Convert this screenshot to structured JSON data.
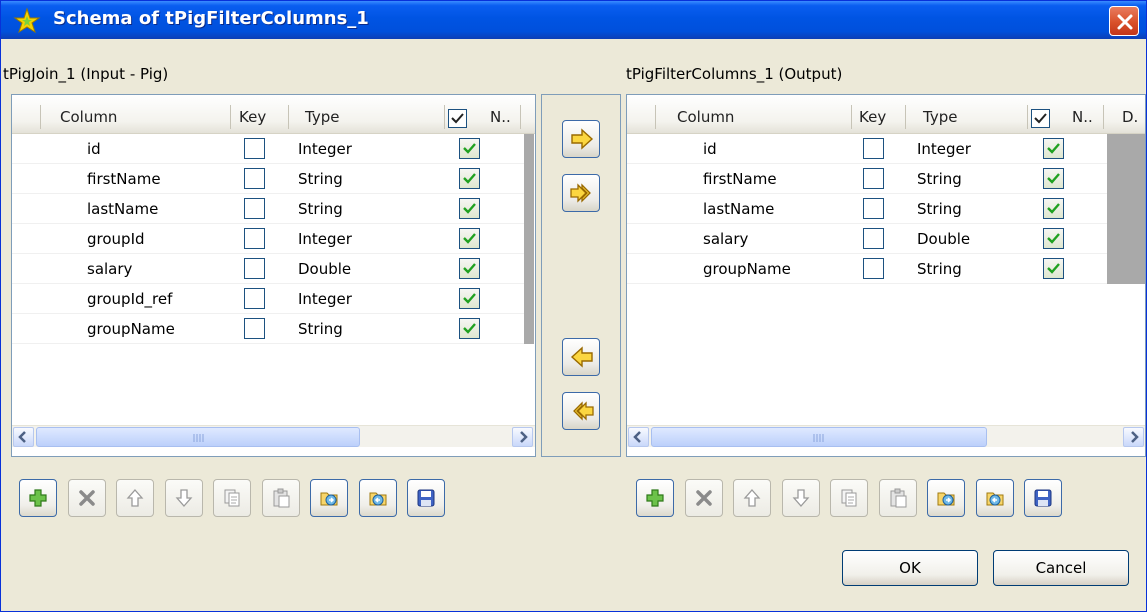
{
  "window": {
    "title": "Schema of tPigFilterColumns_1",
    "accent": "#0054e3"
  },
  "input_panel": {
    "label": "tPigJoin_1 (Input - Pig)",
    "headers": {
      "column": "Column",
      "key": "Key",
      "type": "Type",
      "nullable": "N.."
    },
    "rows": [
      {
        "column": "id",
        "key": false,
        "type": "Integer",
        "nullable": true
      },
      {
        "column": "firstName",
        "key": false,
        "type": "String",
        "nullable": true
      },
      {
        "column": "lastName",
        "key": false,
        "type": "String",
        "nullable": true
      },
      {
        "column": "groupId",
        "key": false,
        "type": "Integer",
        "nullable": true
      },
      {
        "column": "salary",
        "key": false,
        "type": "Double",
        "nullable": true
      },
      {
        "column": "groupId_ref",
        "key": false,
        "type": "Integer",
        "nullable": true
      },
      {
        "column": "groupName",
        "key": false,
        "type": "String",
        "nullable": true
      }
    ]
  },
  "output_panel": {
    "label": "tPigFilterColumns_1 (Output)",
    "headers": {
      "column": "Column",
      "key": "Key",
      "type": "Type",
      "nullable": "N..",
      "default": "D."
    },
    "rows": [
      {
        "column": "id",
        "key": false,
        "type": "Integer",
        "nullable": true
      },
      {
        "column": "firstName",
        "key": false,
        "type": "String",
        "nullable": true
      },
      {
        "column": "lastName",
        "key": false,
        "type": "String",
        "nullable": true
      },
      {
        "column": "salary",
        "key": false,
        "type": "Double",
        "nullable": true
      },
      {
        "column": "groupName",
        "key": false,
        "type": "String",
        "nullable": true
      }
    ]
  },
  "transfer_buttons": [
    "copy-selected-right-icon",
    "copy-all-right-icon",
    "copy-selected-left-icon",
    "copy-all-left-icon"
  ],
  "toolbar_icons": [
    "add-icon",
    "delete-icon",
    "move-up-icon",
    "move-down-icon",
    "copy-icon",
    "paste-icon",
    "import-icon",
    "export-icon",
    "save-icon"
  ],
  "buttons": {
    "ok": "OK",
    "cancel": "Cancel"
  }
}
